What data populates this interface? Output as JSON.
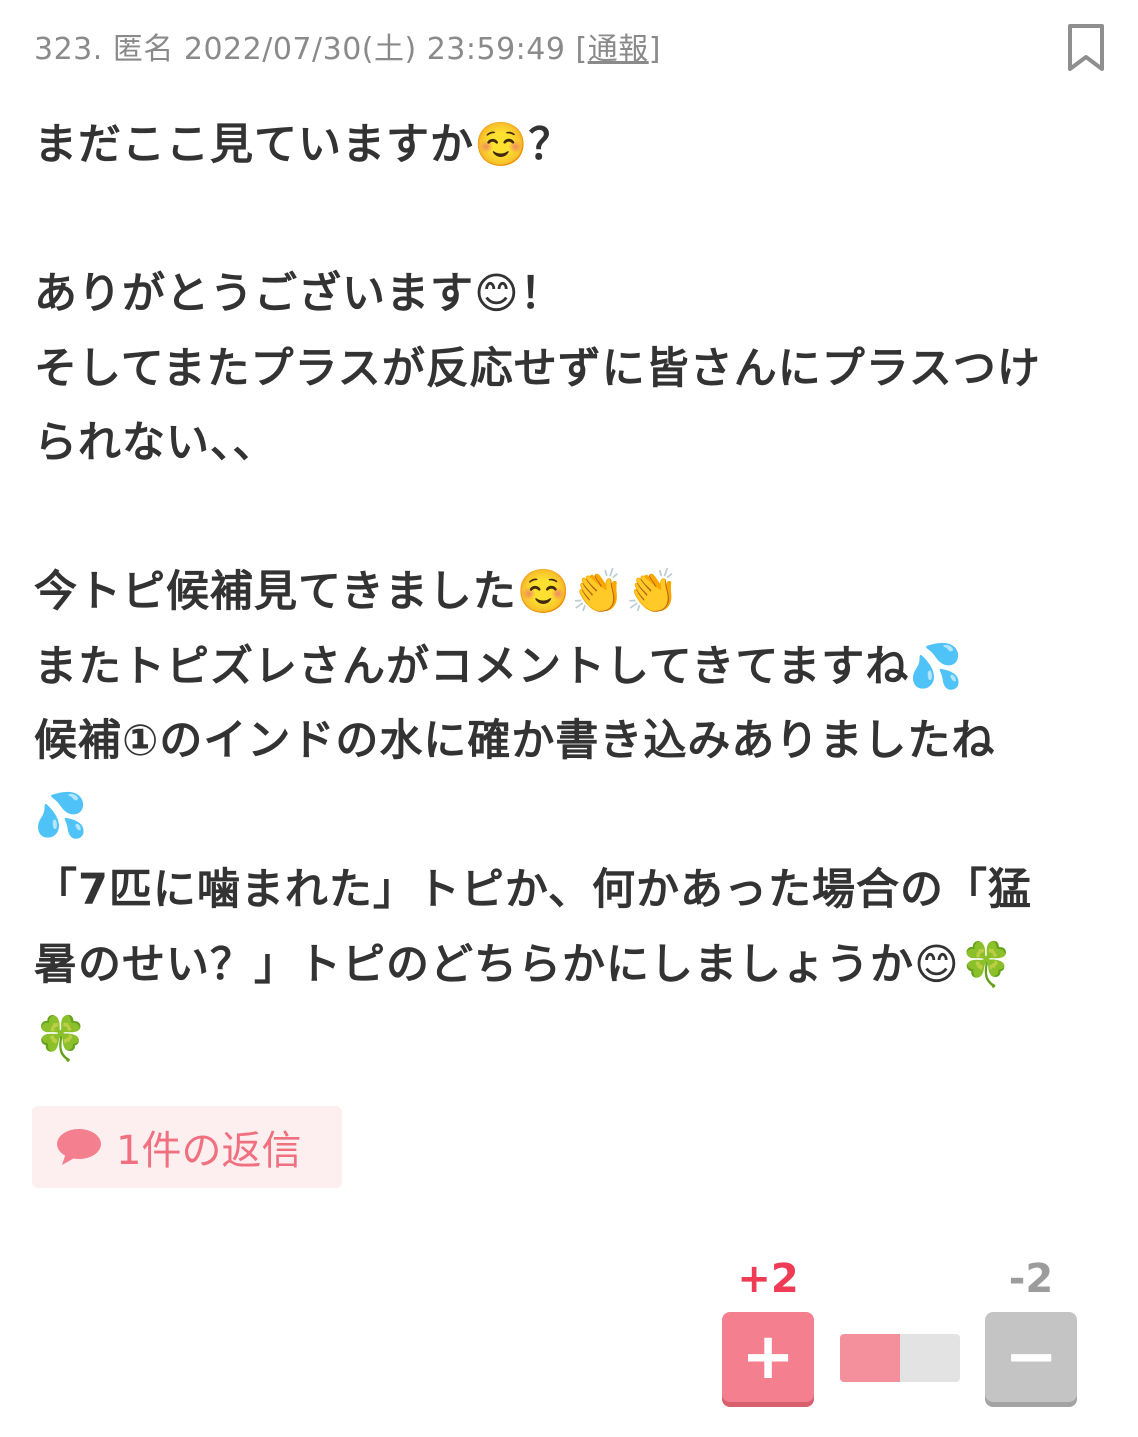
{
  "comment": {
    "header_prefix": "323. 匿名 2022/07/30(土) 23:59:49 [",
    "report_link": "通報",
    "header_suffix": "]",
    "lines": [
      "まだここ見ていますか☺️？",
      "",
      "ありがとうございます😊！",
      "そしてまたプラスが反応せずに皆さんにプラスつけ",
      "られない、、",
      "",
      "今トピ候補見てきました☺️👏👏",
      "またトピズレさんがコメントしてきてますね💦",
      "候補①のインドの水に確か書き込みありましたね",
      "💦",
      "「7匹に噛まれた」トピか、何かあった場合の「猛",
      "暑のせい？」トピのどちらかにしましょうか😊🍀",
      "🍀"
    ],
    "reply_label": "1件の返信"
  },
  "votes": {
    "plus_count": "+2",
    "minus_count": "-2",
    "plus_symbol": "+",
    "minus_symbol": "−",
    "plus_ratio": 0.5,
    "plus_color": "#f47f8e",
    "minus_color": "#c4c4c4"
  },
  "icons": {
    "bookmark": "bookmark-icon",
    "reply": "speech-bubble-icon"
  }
}
